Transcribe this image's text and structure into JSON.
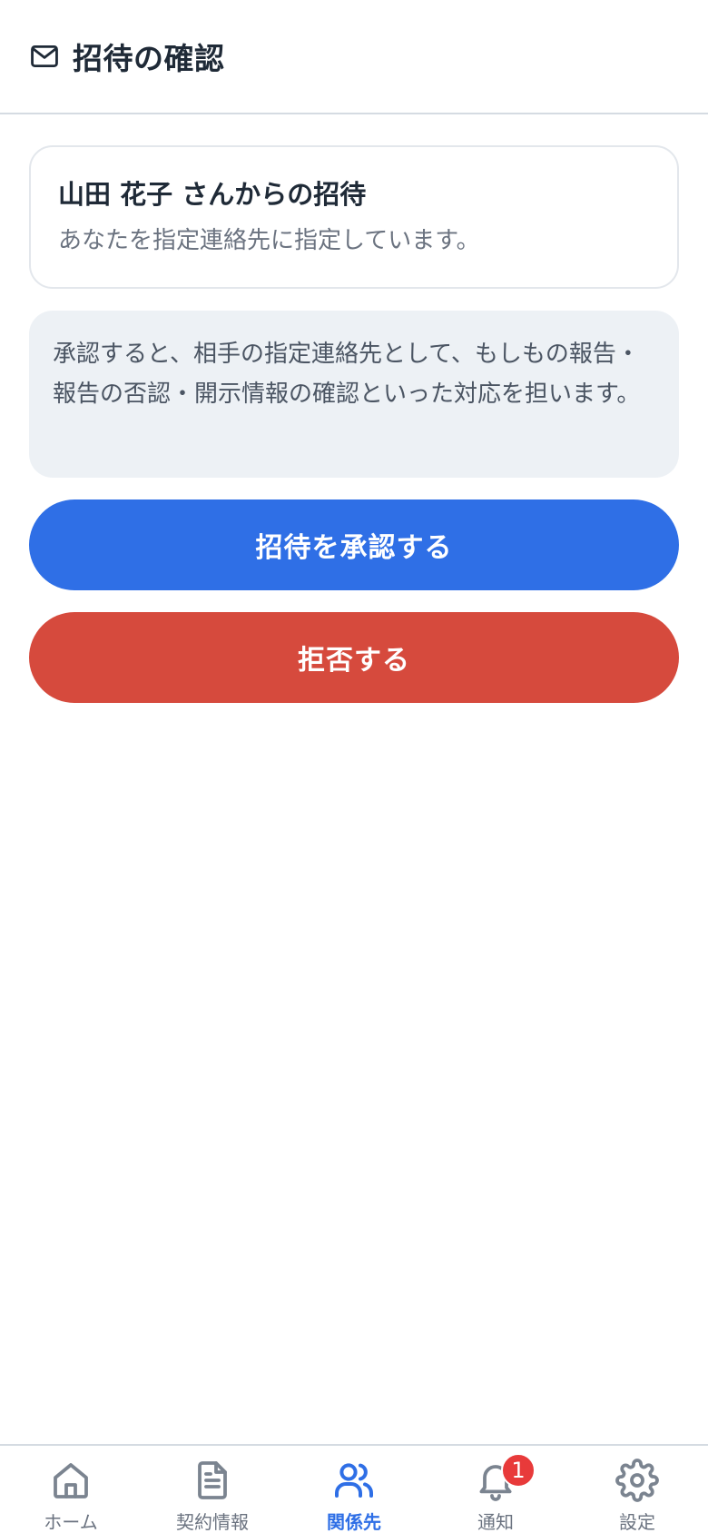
{
  "header": {
    "icon": "mail-icon",
    "title": "招待の確認"
  },
  "invite": {
    "title": "山田 花子 さんからの招待",
    "subtitle": "あなたを指定連絡先に指定しています。"
  },
  "info": {
    "text": "承認すると、相手の指定連絡先として、もしもの報告・報告の否認・開示情報の確認といった対応を担います。"
  },
  "actions": {
    "accept_label": "招待を承認する",
    "reject_label": "拒否する"
  },
  "tabs": [
    {
      "label": "ホーム",
      "icon": "home-icon",
      "active": false
    },
    {
      "label": "契約情報",
      "icon": "document-icon",
      "active": false
    },
    {
      "label": "関係先",
      "icon": "users-icon",
      "active": true
    },
    {
      "label": "通知",
      "icon": "bell-icon",
      "active": false,
      "badge": "1"
    },
    {
      "label": "設定",
      "icon": "gear-icon",
      "active": false
    }
  ],
  "colors": {
    "accent": "#2f6fe6",
    "danger": "#d64a3d",
    "badge": "#e83a3a"
  }
}
